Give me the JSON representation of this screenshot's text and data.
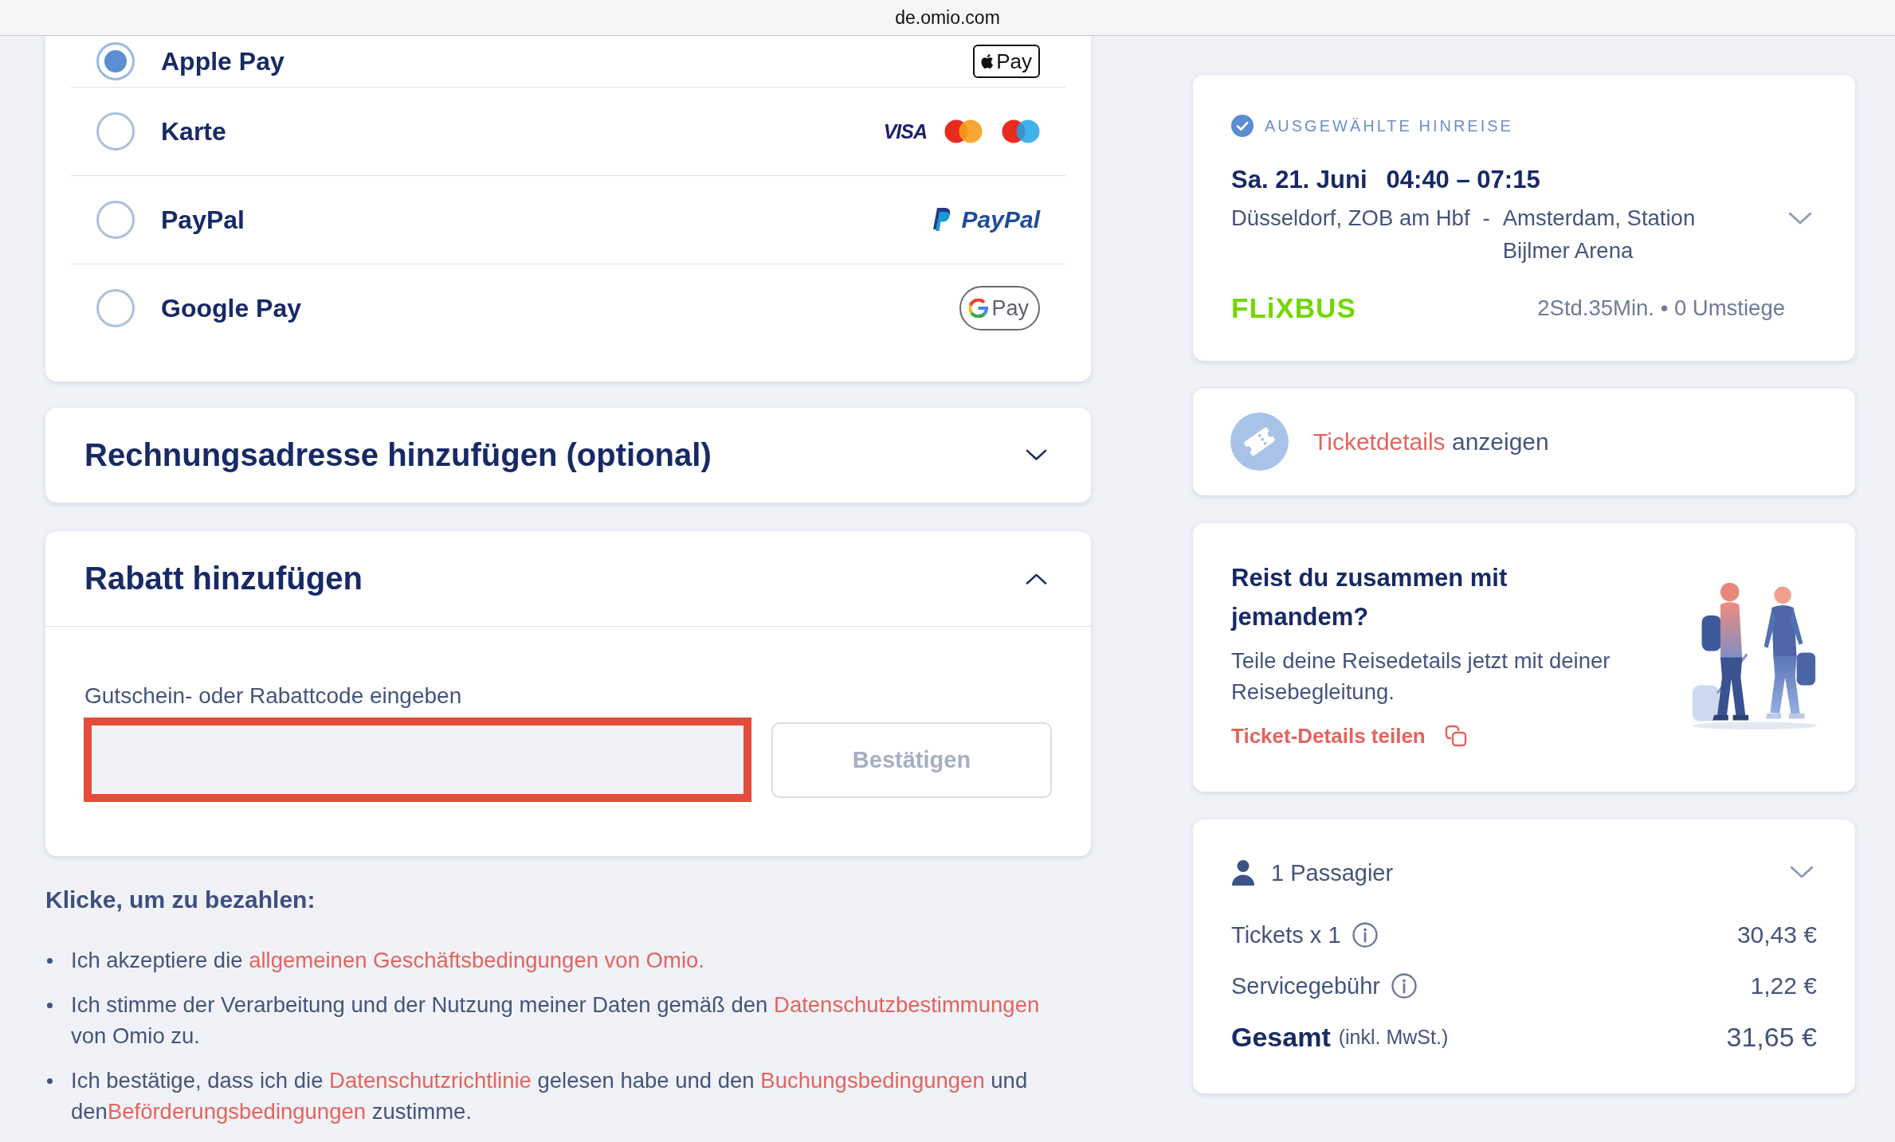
{
  "browser_bar": {
    "url": "de.omio.com"
  },
  "payment_methods": [
    {
      "kind": "applepay",
      "label": "Apple Pay",
      "selected": true,
      "logo_text": "Pay"
    },
    {
      "kind": "card",
      "label": "Karte",
      "selected": false,
      "logo_text": "VISA"
    },
    {
      "kind": "paypal",
      "label": "PayPal",
      "selected": false,
      "logo_text": "PayPal"
    },
    {
      "kind": "googlepay",
      "label": "Google Pay",
      "selected": false,
      "logo_text": "Pay"
    }
  ],
  "billing_address": {
    "title": "Rechnungsadresse hinzufügen (optional)",
    "expanded": false
  },
  "discount": {
    "title": "Rabatt hinzufügen",
    "expanded": true,
    "field": {
      "label": "Gutschein- oder Rabattcode eingeben",
      "highlighted": true
    },
    "button": {
      "label": "Bestätigen",
      "disabled": true
    }
  },
  "terms": {
    "heading": "Klicke, um zu bezahlen:",
    "items": [
      {
        "parts": [
          {
            "kind": "text",
            "text": "Ich akzeptiere die "
          },
          {
            "kind": "link",
            "text": "allgemeinen Geschäftsbedingungen von Omio."
          }
        ]
      },
      {
        "parts": [
          {
            "kind": "text",
            "text": "Ich stimme der Verarbeitung und der Nutzung meiner Daten gemäß den "
          },
          {
            "kind": "link",
            "text": "Datenschutzbestimmungen"
          },
          {
            "kind": "text",
            "text": " von Omio zu."
          }
        ]
      },
      {
        "parts": [
          {
            "kind": "text",
            "text": "Ich bestätige, dass ich die "
          },
          {
            "kind": "link",
            "text": "Datenschutzrichtlinie"
          },
          {
            "kind": "text",
            "text": " gelesen habe und den "
          },
          {
            "kind": "link",
            "text": "Buchungsbedingungen"
          },
          {
            "kind": "text",
            "text": " und den"
          },
          {
            "kind": "link",
            "text": "Beförderungsbedingungen"
          },
          {
            "kind": "text",
            "text": " zustimme."
          }
        ]
      }
    ]
  },
  "outbound": {
    "label": "AUSGEWÄHLTE HINREISE",
    "date": "Sa. 21. Juni",
    "time": "04:40 – 07:15",
    "from": "Düsseldorf, ZOB am Hbf",
    "separator": "-",
    "to": "Amsterdam, Station Bijlmer Arena",
    "expanded": false,
    "operator": "FLiXBUS",
    "summary": "2Std.35Min. • 0 Umstiege"
  },
  "ticket_details": {
    "parts": [
      {
        "kind": "link",
        "text": "Ticketdetails"
      },
      {
        "kind": "text",
        "text": " anzeigen"
      }
    ]
  },
  "share": {
    "title": "Reist du zusammen mit jemandem?",
    "text": "Teile deine Reisedetails jetzt mit deiner Reisebegleitung.",
    "link": "Ticket-Details teilen"
  },
  "price": {
    "passengers": "1 Passagier",
    "expanded": false,
    "lines": [
      {
        "kind": "item",
        "label": "Tickets x 1",
        "info": true,
        "amount": "30,43 €"
      },
      {
        "kind": "item",
        "label": "Servicegebühr",
        "info": true,
        "amount": "1,22 €"
      },
      {
        "kind": "total",
        "label": "Gesamt",
        "note": "(inkl. MwSt.)",
        "amount": "31,65 €"
      }
    ]
  }
}
